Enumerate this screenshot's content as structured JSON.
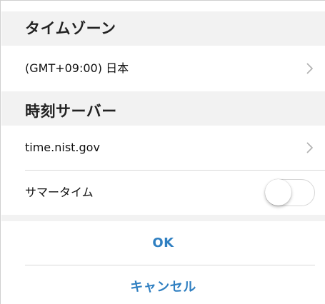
{
  "timezone_section": {
    "header": "タイムゾーン",
    "value": "(GMT+09:00) 日本"
  },
  "time_server_section": {
    "header": "時刻サーバー",
    "server_value": "time.nist.gov",
    "daylight_saving_label": "サマータイム",
    "daylight_saving_enabled": false
  },
  "actions": {
    "ok_label": "OK",
    "cancel_label": "キャンセル"
  },
  "colors": {
    "accent": "#2f7fc1",
    "section_background": "#f2f2f2",
    "divider": "#d9d9d9"
  },
  "icons": {
    "row_disclosure": "chevron-right-icon"
  }
}
